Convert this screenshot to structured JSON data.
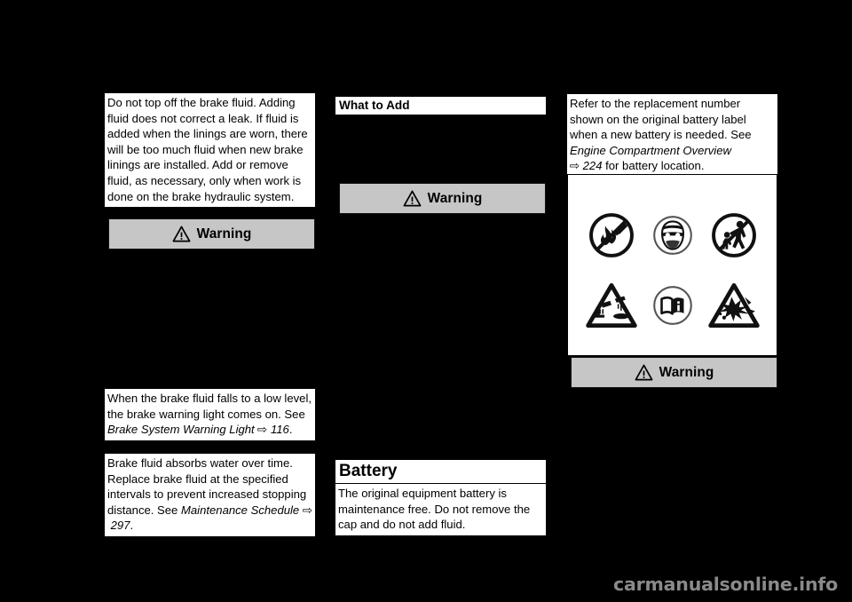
{
  "page": {
    "background_color": "#000000",
    "paper_color": "#ffffff",
    "warning_bar_color": "#c6c6c6",
    "watermark": "carmanualsonline.info"
  },
  "left_column": {
    "brake_fluid_note": "Do not top off the brake fluid. Adding fluid does not correct a leak. If fluid is added when the linings are worn, there will be too much fluid when new brake linings are installed. Add or remove fluid, as necessary, only when work is done on the brake hydraulic system.",
    "warning_label": "Warning",
    "low_level_note_part1": "When the brake fluid falls to a low level, the brake warning light comes on. See ",
    "low_level_reference": "Brake System Warning Light",
    "low_level_arrow": "⇨",
    "low_level_page": "116",
    "low_level_end": ".",
    "absorbs_water_part1": "Brake fluid absorbs water over time. Replace brake fluid at the specified intervals to prevent increased stopping distance. See ",
    "absorbs_water_reference": "Maintenance Schedule",
    "absorbs_water_arrow": "⇨",
    "absorbs_water_page": "297",
    "absorbs_water_end": "."
  },
  "mid_column": {
    "what_to_add_heading": "What to Add",
    "warning_label": "Warning",
    "battery_heading": "Battery",
    "battery_note": "The original equipment battery is maintenance free. Do not remove the cap and do not add fluid."
  },
  "right_column": {
    "replacement_note_part1": "Refer to the replacement number shown on the original battery label when a new battery is needed. See ",
    "replacement_reference": "Engine Compartment Overview",
    "replacement_arrow": "⇨",
    "replacement_page": "224",
    "replacement_end": " for battery location.",
    "warning_label": "Warning",
    "symbols": [
      {
        "name": "no-flames-sparks-smoking-icon",
        "label": "No flames, sparks or smoking"
      },
      {
        "name": "eye-protection-icon",
        "label": "Wear eye protection"
      },
      {
        "name": "keep-children-away-icon",
        "label": "Keep children away"
      },
      {
        "name": "battery-acid-corrosive-icon",
        "label": "Corrosive battery acid"
      },
      {
        "name": "read-manual-icon",
        "label": "Read owner manual"
      },
      {
        "name": "explosive-gas-icon",
        "label": "Explosive gas"
      }
    ]
  }
}
